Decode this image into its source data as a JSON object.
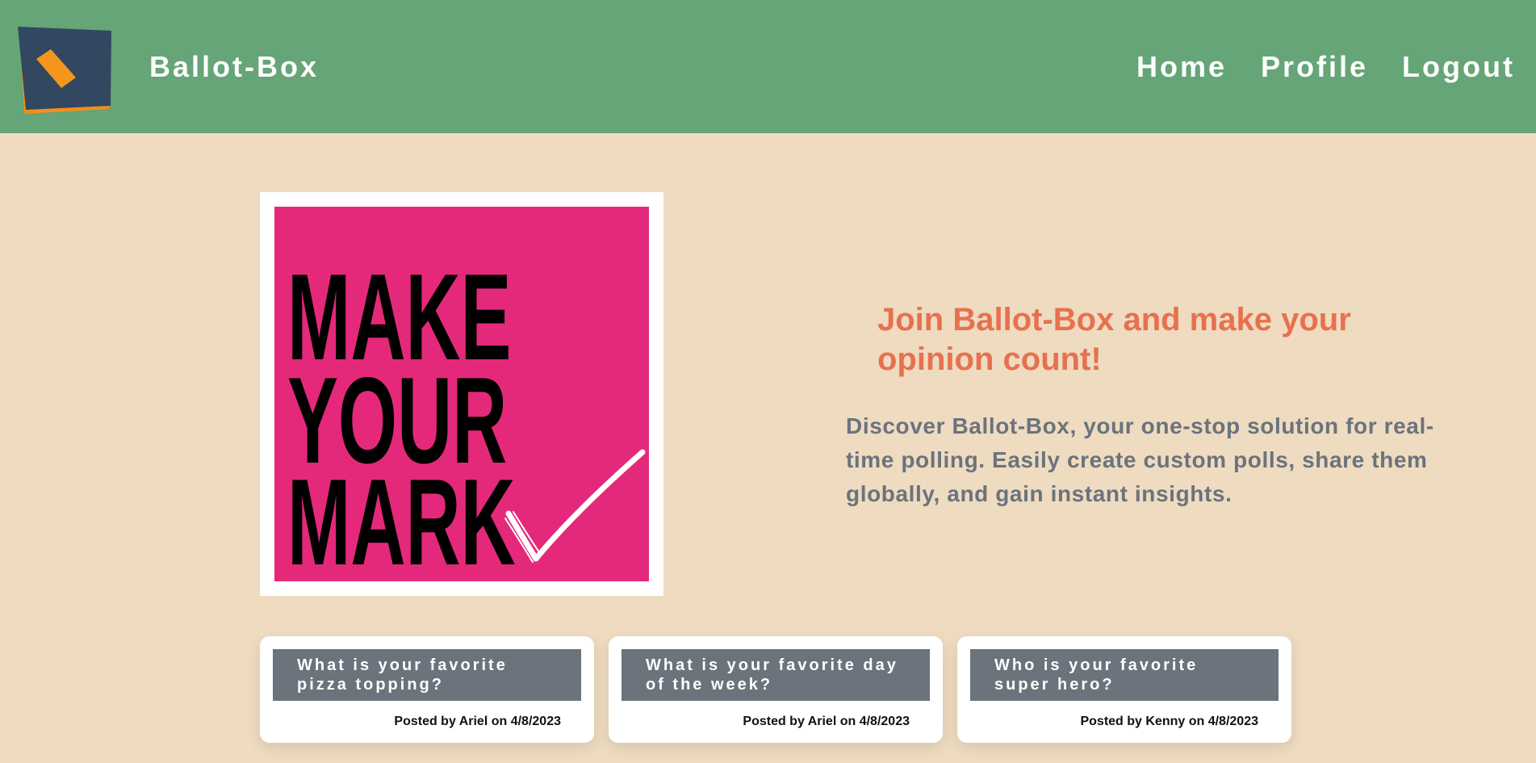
{
  "navbar": {
    "brand": "Ballot-Box",
    "links": [
      "Home",
      "Profile",
      "Logout"
    ],
    "background": "#65a577"
  },
  "hero": {
    "image_text": [
      "MAKE",
      "YOUR",
      "MARK"
    ],
    "heading": "Join Ballot-Box and make your opinion count!",
    "description": "Discover Ballot-Box, your one-stop solution for real-time polling. Easily create custom polls, share them globally, and gain instant insights."
  },
  "polls": [
    {
      "title": "What is your favorite pizza topping?",
      "meta": "Posted by Ariel on 4/8/2023"
    },
    {
      "title": "What is your favorite day of the week?",
      "meta": "Posted by Ariel on 4/8/2023"
    },
    {
      "title": "Who is your favorite super hero?",
      "meta": "Posted by Kenny on 4/8/2023"
    }
  ],
  "colors": {
    "page_background": "#eedbc0",
    "accent": "#e8704f",
    "poster": "#e4297a",
    "card_header": "#6b737c"
  },
  "icons": {
    "logo": "ballot-box-logo-icon",
    "check": "checkmark-icon"
  }
}
